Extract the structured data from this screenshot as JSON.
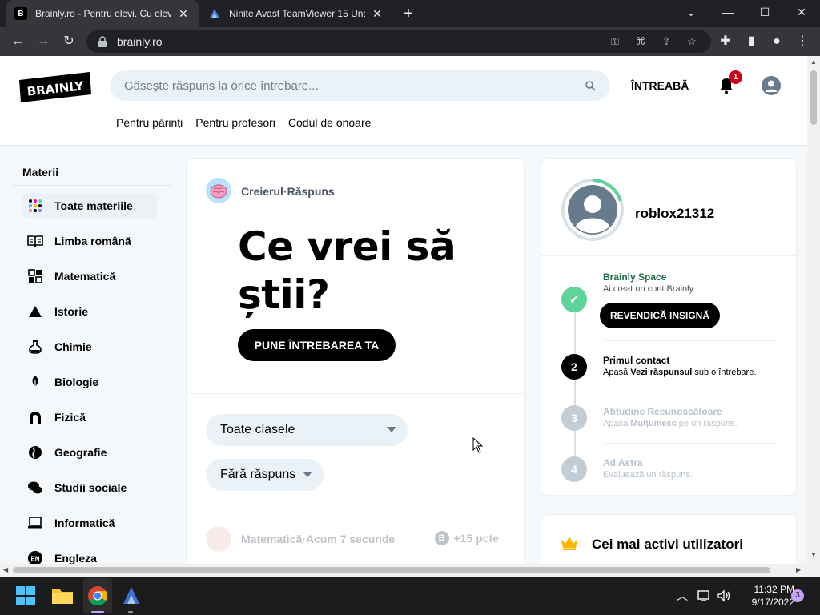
{
  "browser": {
    "tabs": [
      {
        "title": "Brainly.ro - Pentru elevi. Cu elevi.",
        "active": true
      },
      {
        "title": "Ninite Avast TeamViewer 15 Unat",
        "active": false
      }
    ],
    "new_tab": "+",
    "url": "brainly.ro",
    "window_controls": {
      "minimize": "—",
      "maximize": "☐",
      "close": "✕",
      "dropdown": "⌄"
    }
  },
  "header": {
    "logo": "BRAINLY",
    "search_placeholder": "Găsește răspuns la orice întrebare...",
    "ask_label": "ÎNTREABĂ",
    "notifications_count": "1",
    "links": [
      "Pentru părinți",
      "Pentru profesori",
      "Codul de onoare"
    ]
  },
  "sidebar": {
    "title": "Materii",
    "items": [
      {
        "label": "Toate materiile",
        "icon": "all-subjects-icon"
      },
      {
        "label": "Limba română",
        "icon": "book-icon"
      },
      {
        "label": "Matematică",
        "icon": "calculator-icon"
      },
      {
        "label": "Istorie",
        "icon": "pyramid-icon"
      },
      {
        "label": "Chimie",
        "icon": "flask-icon"
      },
      {
        "label": "Biologie",
        "icon": "leaf-icon"
      },
      {
        "label": "Fizică",
        "icon": "magnet-icon"
      },
      {
        "label": "Geografie",
        "icon": "globe-icon"
      },
      {
        "label": "Studii sociale",
        "icon": "chat-bubbles-icon"
      },
      {
        "label": "Informatică",
        "icon": "laptop-icon"
      },
      {
        "label": "Engleza",
        "icon": "en-badge-icon"
      }
    ]
  },
  "main": {
    "meta_author": "Creierul",
    "meta_separator": "·",
    "meta_type": "Răspuns",
    "hero_title": "Ce vrei să știi?",
    "ask_button": "PUNE ÎNTREBAREA TA",
    "filter_class": "Toate clasele",
    "filter_status": "Fără răspuns",
    "question_preview": {
      "subject": "Matematică",
      "time": "Acum 7 secunde",
      "points": "+15 pcte"
    }
  },
  "profile": {
    "username": "roblox21312",
    "progress_fraction": 0.2,
    "steps": [
      {
        "number": "✓",
        "title": "Brainly Space",
        "subtitle": "Ai creat un cont Brainly.",
        "state": "done"
      },
      {
        "number": "2",
        "title": "Primul contact",
        "subtitle_pre": "Apasă ",
        "subtitle_bold": "Vezi răspunsul",
        "subtitle_post": " sub o întrebare.",
        "state": "current"
      },
      {
        "number": "3",
        "title": "Atitudine Recunoscătoare",
        "subtitle_pre": "Apasă ",
        "subtitle_bold": "Mulțumesc",
        "subtitle_post": " pe un răspuns.",
        "state": "pending"
      },
      {
        "number": "4",
        "title": "Ad Astra",
        "subtitle": "Evaluează un răspuns.",
        "state": "pending"
      }
    ],
    "claim_button": "REVENDICĂ INSIGNĂ"
  },
  "active_users": {
    "title": "Cei mai activi utilizatori"
  },
  "taskbar": {
    "time": "11:32 PM",
    "date": "9/17/2022",
    "notification_count": "3"
  },
  "colors": {
    "brand_black": "#000000",
    "search_bg": "#ebf2f7",
    "accent_green": "#60d399",
    "badge_red": "#d0021b"
  }
}
